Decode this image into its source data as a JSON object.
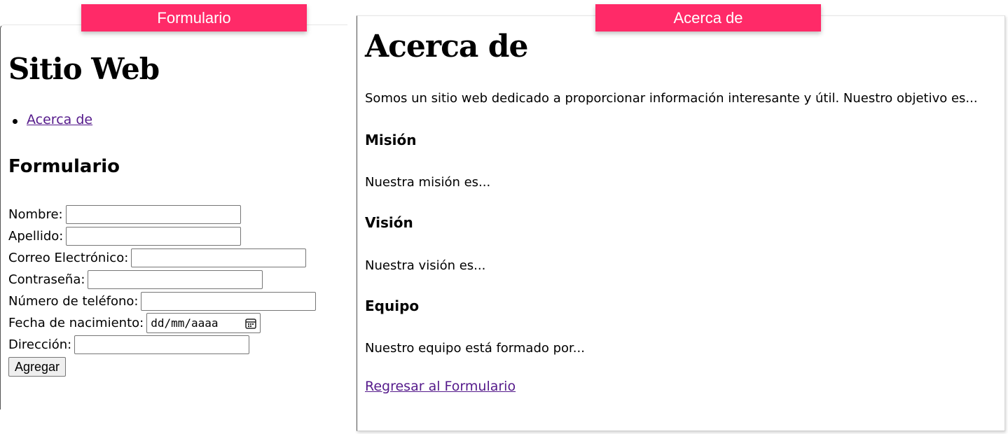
{
  "tags": {
    "left": "Formulario",
    "right": "Acerca de"
  },
  "form_page": {
    "site_title": "Sitio Web",
    "nav": [
      {
        "label": "Acerca de"
      }
    ],
    "form_heading": "Formulario",
    "fields": [
      {
        "label": "Nombre:",
        "value": ""
      },
      {
        "label": "Apellido:",
        "value": ""
      },
      {
        "label": "Correo Electrónico:",
        "value": ""
      },
      {
        "label": "Contraseña:",
        "value": ""
      },
      {
        "label": "Número de teléfono:",
        "value": ""
      },
      {
        "label": "Fecha de nacimiento:",
        "placeholder": "dd/mm/aaaa"
      },
      {
        "label": "Dirección:",
        "value": ""
      }
    ],
    "submit_label": "Agregar"
  },
  "about_page": {
    "title": "Acerca de",
    "intro": "Somos un sitio web dedicado a proporcionar información interesante y útil. Nuestro objetivo es...",
    "mission_heading": "Misión",
    "mission_text": "Nuestra misión es...",
    "vision_heading": "Visión",
    "vision_text": "Nuestra visión es...",
    "team_heading": "Equipo",
    "team_text": "Nuestro equipo está formado por...",
    "back_link": "Regresar al Formulario"
  },
  "colors": {
    "tag_bg": "#ff2a68",
    "tag_text": "#ffffff",
    "link": "#551a8b"
  },
  "icons": {
    "date_picker": "calendar-icon",
    "bullet": "disc-bullet"
  }
}
